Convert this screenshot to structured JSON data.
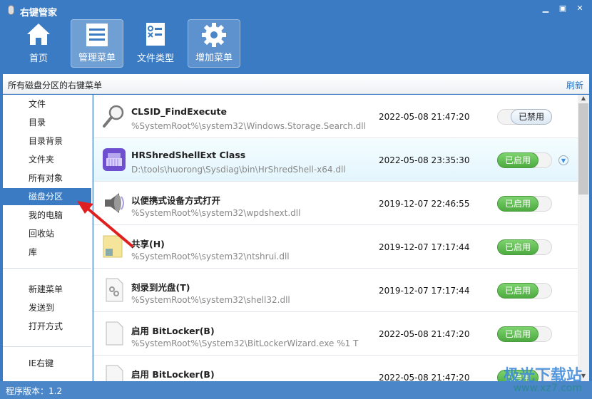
{
  "app": {
    "title": "右键管家"
  },
  "window_controls": [
    "minimize",
    "restore",
    "close"
  ],
  "toolbar": [
    {
      "label": "首页",
      "icon": "home-icon"
    },
    {
      "label": "管理菜单",
      "icon": "menu-list-icon",
      "selected": true
    },
    {
      "label": "文件类型",
      "icon": "file-type-icon"
    },
    {
      "label": "增加菜单",
      "icon": "gear-icon"
    }
  ],
  "subheader": {
    "title": "所有磁盘分区的右键菜单",
    "refresh": "刷新"
  },
  "sidebar": {
    "group1": [
      "文件",
      "目录",
      "目录背景",
      "文件夹",
      "所有对象",
      "磁盘分区",
      "我的电脑",
      "回收站",
      "库"
    ],
    "selected": "磁盘分区",
    "group2": [
      "新建菜单",
      "发送到",
      "打开方式"
    ],
    "group3": [
      "IE右键"
    ]
  },
  "rows": [
    {
      "name": "CLSID_FindExecute",
      "path": "%SystemRoot%\\system32\\Windows.Storage.Search.dll",
      "date": "2022-05-08 21:47:20",
      "status": "已禁用",
      "enabled": false,
      "icon": "magnifier-icon"
    },
    {
      "name": "HRShredShellExt Class",
      "path": "D:\\tools\\huorong\\Sysdiag\\bin\\HrShredShell-x64.dll",
      "date": "2022-05-08 23:35:30",
      "status": "已启用",
      "enabled": true,
      "icon": "shredder-icon",
      "highlighted": true
    },
    {
      "name": "以便携式设备方式打开",
      "path": "%SystemRoot%\\system32\\wpdshext.dll",
      "date": "2019-12-07 22:46:55",
      "status": "已启用",
      "enabled": true,
      "icon": "speaker-icon"
    },
    {
      "name": "共享(H)",
      "path": "%SystemRoot%\\system32\\ntshrui.dll",
      "date": "2019-12-07 17:17:44",
      "status": "已启用",
      "enabled": true,
      "icon": "share-folder-icon"
    },
    {
      "name": "刻录到光盘(T)",
      "path": "%SystemRoot%\\system32\\shell32.dll",
      "date": "2019-12-07 17:17:44",
      "status": "已启用",
      "enabled": true,
      "icon": "settings-file-icon"
    },
    {
      "name": "启用 BitLocker(B)",
      "path": "%SystemRoot%\\System32\\BitLockerWizard.exe %1 T",
      "date": "2022-05-08 21:47:20",
      "status": "已启用",
      "enabled": true,
      "icon": "blank-file-icon"
    },
    {
      "name": "启用 BitLocker(B)",
      "path": "",
      "date": "2022-05-08 21:47:20",
      "status": "已启用",
      "enabled": true,
      "icon": "blank-file-icon"
    }
  ],
  "status": {
    "version": "程序版本：1.2"
  },
  "watermark": {
    "name": "极光下载站",
    "url": "www.xz7.com"
  },
  "colors": {
    "accent": "#3a7bc4",
    "enabled": "#5cb84c"
  }
}
